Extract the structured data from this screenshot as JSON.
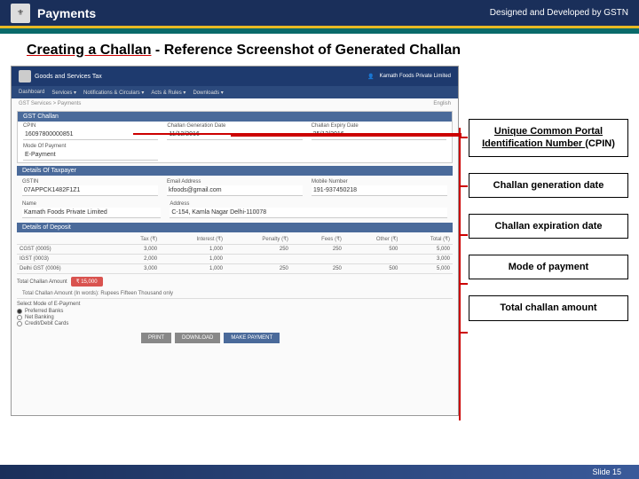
{
  "header": {
    "title": "Payments",
    "credit": "Designed and Developed by GSTN"
  },
  "slide": {
    "title_prefix": "Creating a Challan",
    "title_rest": " - Reference Screenshot of Generated Challan"
  },
  "gst": {
    "brand": "Goods and Services Tax",
    "user": "Kamath Foods Private Limited",
    "menu": [
      "Dashboard",
      "Services ▾",
      "Notifications & Circulars ▾",
      "Acts & Rules ▾",
      "Downloads ▾"
    ],
    "breadcrumb": "GST Services > Payments",
    "lang": "English"
  },
  "challan": {
    "head": "GST Challan",
    "cpin_label": "CPIN",
    "cpin": "16097800000851",
    "gen_label": "Challan Generation Date",
    "gen": "11/12/2016",
    "exp_label": "Challan Expiry Date",
    "exp": "25/12/2016",
    "mode_label": "Mode Of Payment",
    "mode": "E-Payment"
  },
  "taxpayer": {
    "head": "Details Of Taxpayer",
    "gstin_label": "GSTIN",
    "gstin": "07APPCK1482F1Z1",
    "email_label": "Email Address",
    "email": "kfoods@gmail.com",
    "mobile_label": "Mobile Number",
    "mobile": "191-937450218",
    "name_label": "Name",
    "name": "Kamath Foods Private Limited",
    "addr_label": "Address",
    "addr": "C-154, Kamla Nagar Delhi-110078"
  },
  "deposit": {
    "head": "Details of Deposit",
    "cols": [
      "",
      "Tax (₹)",
      "Interest (₹)",
      "Penalty (₹)",
      "Fees (₹)",
      "Other (₹)",
      "Total (₹)"
    ],
    "rows": [
      {
        "name": "CGST (0005)",
        "vals": [
          "3,000",
          "1,000",
          "250",
          "250",
          "500",
          "5,000"
        ]
      },
      {
        "name": "IGST (0003)",
        "vals": [
          "2,000",
          "1,000",
          "   ",
          "   ",
          "   ",
          "3,000"
        ]
      },
      {
        "name": "Delhi GST (0006)",
        "vals": [
          "3,000",
          "1,000",
          "250",
          "250",
          "500",
          "5,000"
        ]
      }
    ],
    "total_label": "Total Challan Amount",
    "total": "₹ 15,000",
    "words_label": "Total Challan Amount (In words)",
    "words": "Rupees Fifteen Thousand only"
  },
  "epay": {
    "head": "Select Mode of E-Payment",
    "opts": [
      "Preferred Banks",
      "Net Banking",
      "Credit/Debit Cards"
    ]
  },
  "buttons": {
    "print": "PRINT",
    "download": "DOWNLOAD",
    "pay": "MAKE PAYMENT"
  },
  "callouts": {
    "c1": "Unique Common Portal Identification Number (CPIN)",
    "c2": "Challan generation date",
    "c3": "Challan expiration date",
    "c4": "Mode of payment",
    "c5": "Total challan amount"
  },
  "footer": {
    "slide": "Slide 15"
  }
}
